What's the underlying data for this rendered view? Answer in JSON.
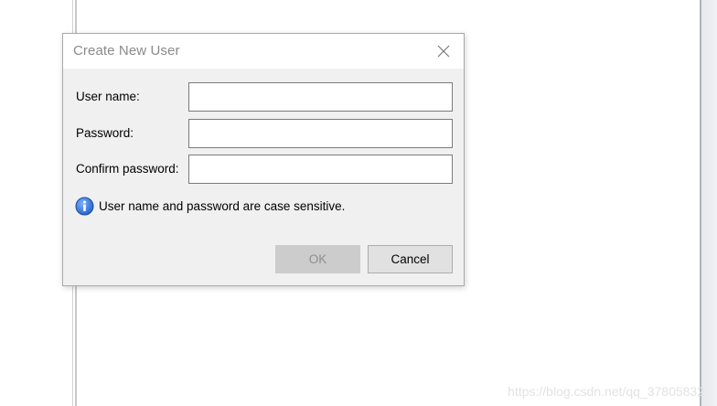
{
  "dialog": {
    "title": "Create New User",
    "fields": [
      {
        "label": "User name:",
        "value": ""
      },
      {
        "label": "Password:",
        "value": ""
      },
      {
        "label": "Confirm password:",
        "value": ""
      }
    ],
    "info_icon": "info-icon",
    "info_text": "User name and password are case sensitive.",
    "ok_label": "OK",
    "ok_enabled": false,
    "cancel_label": "Cancel",
    "close_icon": "close-icon"
  },
  "watermark": "https://blog.csdn.net/qq_37805832",
  "colors": {
    "dialog_bg": "#f0f0f0",
    "titlebar_bg": "#ffffff",
    "title_text": "#8a8a8a",
    "ok_disabled_bg": "#cccccc",
    "cancel_bg": "#e1e1e1",
    "info_icon_blue": "#2b6fd6"
  }
}
